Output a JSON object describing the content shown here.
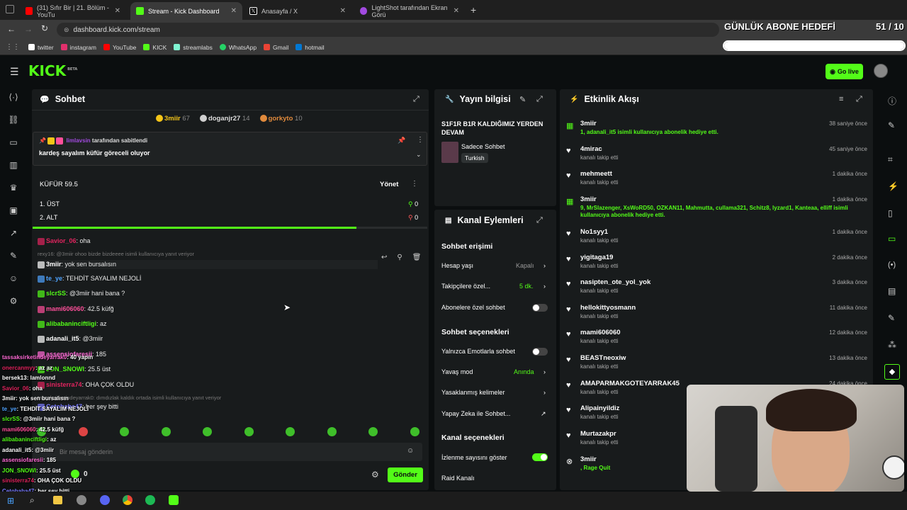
{
  "browser": {
    "tabs": [
      {
        "title": "(31) Sıfır Bir | 21. Bölüm - YouTu",
        "favicon_color": "#ff0000"
      },
      {
        "title": "Stream - Kick Dashboard",
        "favicon_color": "#53fc18",
        "active": true
      },
      {
        "title": "Anasayfa / X",
        "favicon_color": "#ffffff"
      },
      {
        "title": "LightShot tarafından Ekran Görü",
        "favicon_color": "#a24ae0"
      }
    ],
    "url": "dashboard.kick.com/stream",
    "bookmarks": [
      {
        "label": "twitter",
        "color": "#ffffff"
      },
      {
        "label": "instagram",
        "color": "#e1306c"
      },
      {
        "label": "YouTube",
        "color": "#ff0000"
      },
      {
        "label": "KICK",
        "color": "#53fc18"
      },
      {
        "label": "streamlabs",
        "color": "#80f5d2"
      },
      {
        "label": "WhatsApp",
        "color": "#25d366"
      },
      {
        "label": "Gmail",
        "color": "#ea4335"
      },
      {
        "label": "hotmail",
        "color": "#0078d4"
      }
    ]
  },
  "overlay": {
    "sub_goal_title": "GÜNLÜK ABONE HEDEFİ",
    "sub_goal_count": "51 / 10",
    "sub_goal_progress": 1.0
  },
  "header": {
    "logo": "KICK",
    "logo_beta": "BETA",
    "go_live_label": "Go live"
  },
  "chat": {
    "title": "Sohbet",
    "top_gifters": [
      {
        "name": "3miir",
        "count": "67",
        "color": "#f5c518"
      },
      {
        "name": "doganjr27",
        "count": "14",
        "color": "#d0d0d0"
      },
      {
        "name": "gorkyto",
        "count": "10",
        "color": "#e08a3c"
      }
    ],
    "pinned": {
      "pinned_by": "limlavsin",
      "pinned_by_suffix": "tarafından sabitlendi",
      "message": "kardeş sayalım küfür göreceli oluyor"
    },
    "poll": {
      "title": "KÜFÜR 59.5",
      "manage_label": "Yönet",
      "options": [
        {
          "label": "1. ÜST",
          "votes": "0"
        },
        {
          "label": "2. ALT",
          "votes": "0"
        }
      ],
      "progress": 0.82
    },
    "messages": [
      {
        "user": "Savior_06",
        "color": "#e0245e",
        "text": ": oha"
      },
      {
        "reply": "rexy16: @3miir ohoo bizde bizdeeee isimli kullanıcıya yanıt veriyor"
      },
      {
        "user": "3miir",
        "color": "#ffffff",
        "text": ": yok sen bursalısın",
        "highlight": true
      },
      {
        "user": "te_ye",
        "color": "#4fa3ff",
        "text": ": TEHDİT SAYALIM NEJOLİ"
      },
      {
        "user": "slcrSS",
        "color": "#53fc18",
        "text": ": @3miir hani bana ?"
      },
      {
        "user": "mami606060",
        "color": "#ff4f9a",
        "text": ": 42.5 küfğ"
      },
      {
        "user": "alibabaninciftligi",
        "color": "#53fc18",
        "text": ": az"
      },
      {
        "user": "adanali_it5",
        "color": "#ffffff",
        "text": ": @3miir"
      },
      {
        "user": "assensiofaresii",
        "color": "#ff6bd6",
        "text": ": 185"
      },
      {
        "user": "JON_SNOWI",
        "color": "#53fc18",
        "text": ": 25.5 üst"
      },
      {
        "user": "sinisterra74",
        "color": "#e0245e",
        "text": ": OHA ÇOK OLDU"
      },
      {
        "reply": "tassaksirketindeyarrak0: dımdızlak kaldık ortada isimli kullanıcıya yanıt veriyor"
      },
      {
        "user": "Cetobaba47",
        "color": "#7a7aff",
        "text": ": her şey bitti"
      }
    ],
    "input_placeholder": "Bir mesaj gönderin",
    "points": "0",
    "send_label": "Gönder"
  },
  "overlay_chat": [
    {
      "user": "tassaksirketindeyarrak0",
      "color": "#ff6bd6",
      "text": ": 40 yapın"
    },
    {
      "user": "onercanmyy",
      "color": "#e0245e",
      "text": ": az az"
    },
    {
      "user": "bersek13",
      "color": "#ffffff",
      "text": ": lamlonnd"
    },
    {
      "user": "Savior_06",
      "color": "#e0245e",
      "text": ": oha"
    },
    {
      "user": "3miir",
      "color": "#ffffff",
      "text": ": yok sen bursalısın"
    },
    {
      "user": "te_ye",
      "color": "#4fa3ff",
      "text": ": TEHDİT SAYALIM NEJOLİ"
    },
    {
      "user": "slcrSS",
      "color": "#53fc18",
      "text": ": @3miir hani bana ?"
    },
    {
      "user": "mami606060",
      "color": "#ff4f9a",
      "text": ": 42.5 küfğ"
    },
    {
      "user": "alibabaninciftligi",
      "color": "#53fc18",
      "text": ": az"
    },
    {
      "user": "adanali_it5",
      "color": "#ffffff",
      "text": ": @3miir"
    },
    {
      "user": "assensiofaresii",
      "color": "#ff6bd6",
      "text": ": 185"
    },
    {
      "user": "JON_SNOWI",
      "color": "#53fc18",
      "text": ": 25.5 üst"
    },
    {
      "user": "sinisterra74",
      "color": "#e0245e",
      "text": ": OHA ÇOK OLDU"
    },
    {
      "user": "Cetobaba47",
      "color": "#7a7aff",
      "text": ": her şey bitti"
    }
  ],
  "stream_info": {
    "title": "Yayın bilgisi",
    "stream_title": "S1F1R B1R KALDIĞIMIZ YERDEN DEVAM",
    "category": "Sadece Sohbet",
    "language_tag": "Turkish"
  },
  "channel_actions": {
    "title": "Kanal Eylemleri",
    "chat_access_heading": "Sohbet erişimi",
    "account_age_label": "Hesap yaşı",
    "account_age_value": "Kapalı",
    "followers_only_label": "Takipçilere özel...",
    "followers_only_value": "5 dk.",
    "subs_only_label": "Abonelere özel sohbet",
    "chat_options_heading": "Sohbet seçenekleri",
    "emotes_only_label": "Yalnızca Emotlarla sohbet",
    "slow_mode_label": "Yavaş mod",
    "slow_mode_value": "Anında",
    "banned_words_label": "Yasaklanmış kelimeler",
    "ai_chat_label": "Yapay Zeka ile Sohbet...",
    "channel_options_heading": "Kanal seçenekleri",
    "show_viewers_label": "İzlenme sayısını göster",
    "raid_label": "Raid Kanalı"
  },
  "activity": {
    "title": "Etkinlik Akışı",
    "items": [
      {
        "type": "gift",
        "name": "3miir",
        "sub": "1, adanali_it5 isimli kullanıcıya abonelik hediye etti.",
        "time": "38 saniye önce"
      },
      {
        "type": "follow",
        "name": "4mirac",
        "sub": "kanalı takip etti",
        "time": "45 saniye önce"
      },
      {
        "type": "follow",
        "name": "mehmeett",
        "sub": "kanalı takip etti",
        "time": "1 dakika önce"
      },
      {
        "type": "gift",
        "name": "3miir",
        "sub": "9, MrSlazenger, XsWoRD50, OZKAN11, Mahmutta, cullama321, Schitz8, lyzard1, Kanteaa, elliff isimli kullanıcıya abonelik hediye etti.",
        "time": "1 dakika önce"
      },
      {
        "type": "follow",
        "name": "No1syy1",
        "sub": "kanalı takip etti",
        "time": "1 dakika önce"
      },
      {
        "type": "follow",
        "name": "yigitaga19",
        "sub": "kanalı takip etti",
        "time": "2 dakika önce"
      },
      {
        "type": "follow",
        "name": "nasipten_ote_yol_yok",
        "sub": "kanalı takip etti",
        "time": "3 dakika önce"
      },
      {
        "type": "follow",
        "name": "hellokittyosmann",
        "sub": "kanalı takip etti",
        "time": "11 dakika önce"
      },
      {
        "type": "follow",
        "name": "mami606060",
        "sub": "kanalı takip etti",
        "time": "12 dakika önce"
      },
      {
        "type": "follow",
        "name": "BEASTneoxiw",
        "sub": "kanalı takip etti",
        "time": "13 dakika önce"
      },
      {
        "type": "follow",
        "name": "AMAPARMAKGOTEYARRAK45",
        "sub": "kanalı takip etti",
        "time": "24 dakika önce"
      },
      {
        "type": "follow",
        "name": "Alipainyildiz",
        "sub": "kanalı takip etti",
        "time": ""
      },
      {
        "type": "follow",
        "name": "Murtazakpr",
        "sub": "kanalı takip etti",
        "time": ""
      },
      {
        "type": "raid",
        "name": "3miir",
        "sub": ", Rage Quit",
        "time": ""
      }
    ]
  },
  "colors": {
    "accent": "#53fc18",
    "panel": "#181b1c",
    "background": "#0b0e0f"
  }
}
